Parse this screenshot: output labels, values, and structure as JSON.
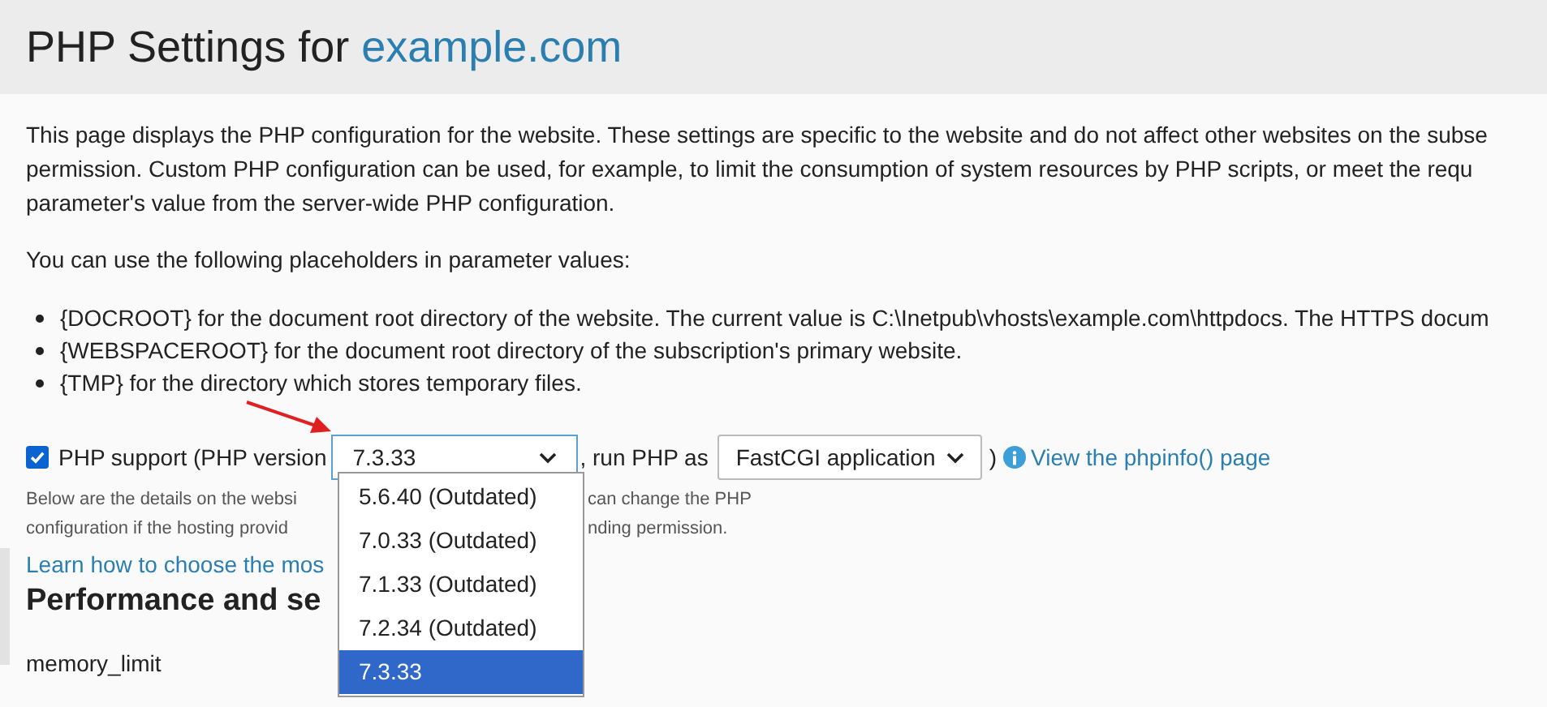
{
  "page_title": {
    "prefix": "PHP Settings for ",
    "domain": "example.com"
  },
  "intro_lines": [
    "This page displays the PHP configuration for the website. These settings are specific to the website and do not affect other websites on the subse",
    "permission. Custom PHP configuration can be used, for example, to limit the consumption of system resources by PHP scripts, or meet the requ",
    "parameter's value from the server-wide PHP configuration."
  ],
  "placeholders_intro": "You can use the following placeholders in parameter values:",
  "placeholders": [
    "{DOCROOT} for the document root directory of the website. The current value is C:\\Inetpub\\vhosts\\example.com\\httpdocs. The HTTPS docum",
    "{WEBSPACEROOT} for the document root directory of the subscription's primary website.",
    "{TMP} for the directory which stores temporary files."
  ],
  "php_support": {
    "checked": true,
    "label": "PHP support (PHP version",
    "version_select": {
      "value": "7.3.33",
      "expanded": true,
      "options": [
        {
          "label": "5.6.40 (Outdated)",
          "selected": false
        },
        {
          "label": "7.0.33 (Outdated)",
          "selected": false
        },
        {
          "label": "7.1.33 (Outdated)",
          "selected": false
        },
        {
          "label": "7.2.34 (Outdated)",
          "selected": false
        },
        {
          "label": "7.3.33",
          "selected": true
        }
      ]
    },
    "run_as_label": ", run PHP as",
    "handler_select": {
      "value": "FastCGI application"
    },
    "close_paren": ")",
    "phpinfo_link": "View the phpinfo() page"
  },
  "details_lines": [
    {
      "left": "Below are the details on the websi",
      "right": "can change the PHP"
    },
    {
      "left": "configuration if the hosting provid",
      "right": "nding permission."
    }
  ],
  "learn_link": "Learn how to choose the mos",
  "section_heading": "Performance and se",
  "settings": [
    {
      "name": "memory_limit"
    }
  ]
}
